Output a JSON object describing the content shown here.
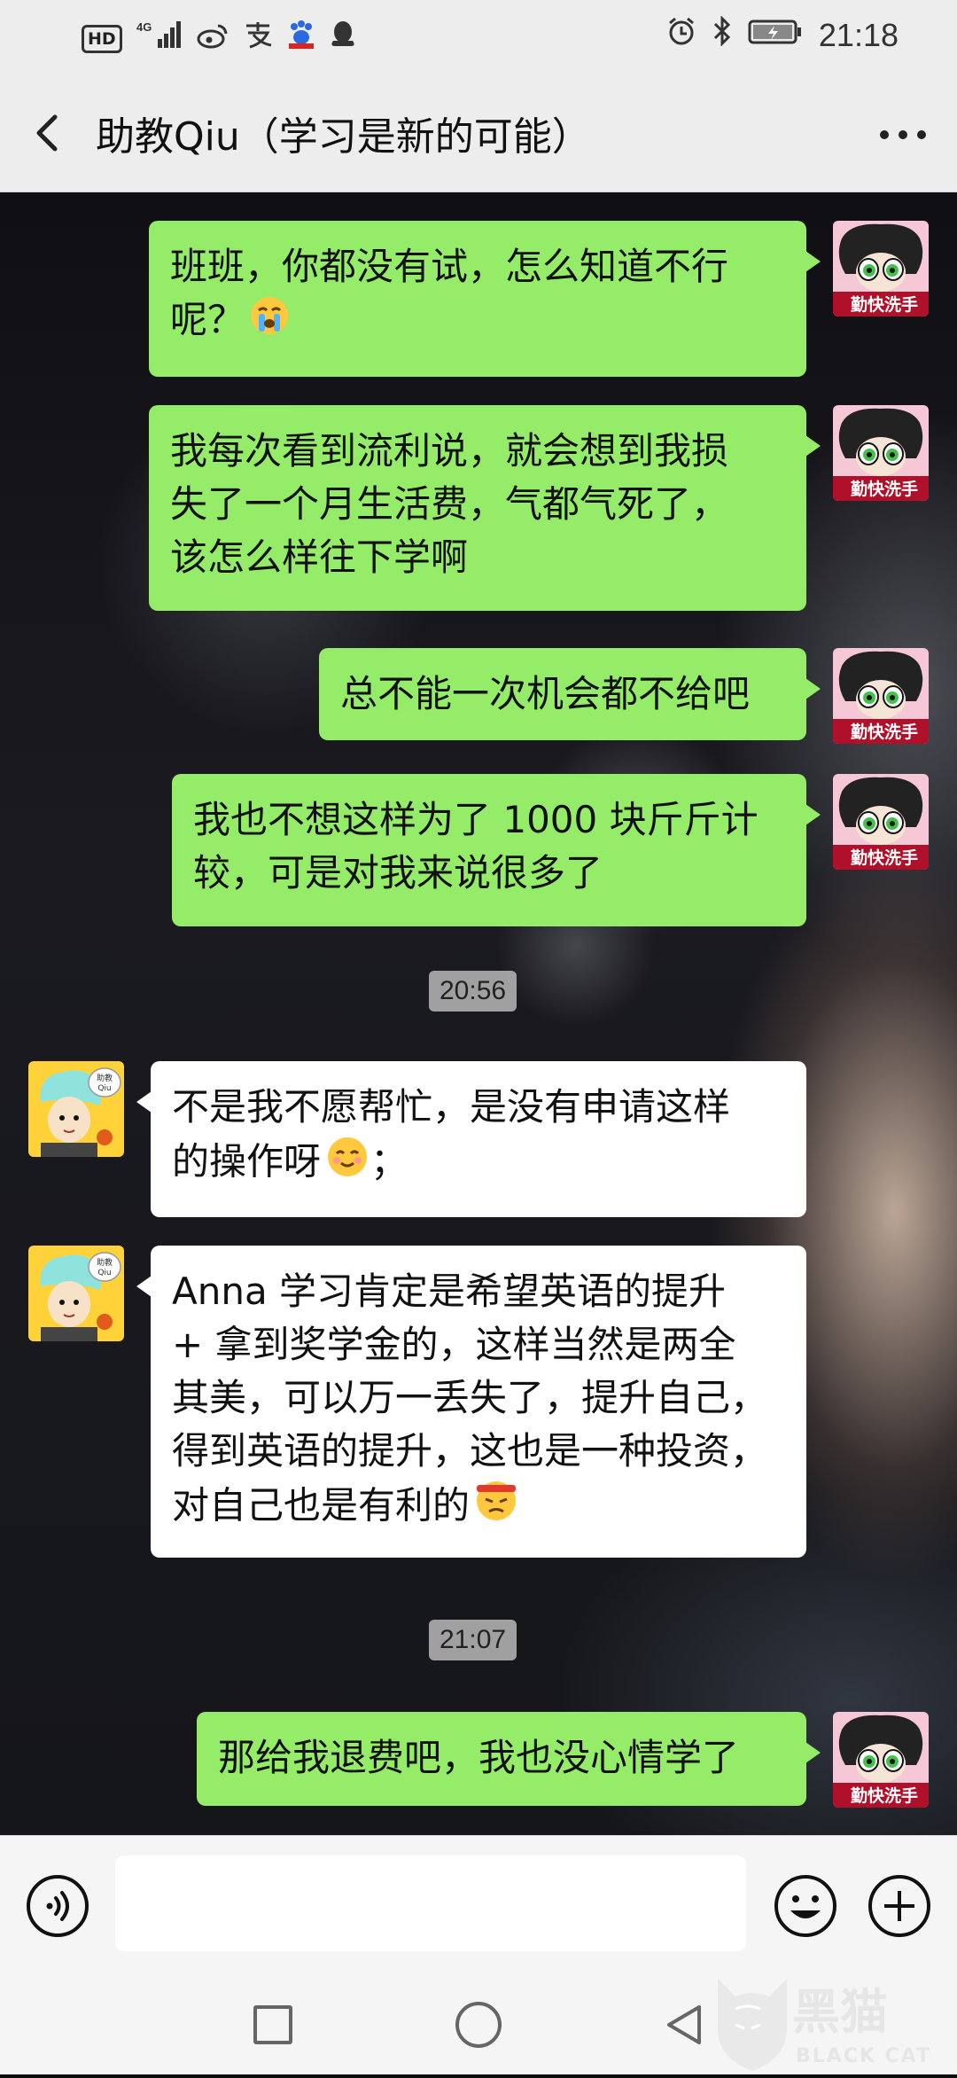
{
  "status_bar": {
    "hd": "HD",
    "network": "4G",
    "time": "21:18"
  },
  "header": {
    "title": "助教Qiu（学习是新的可能）",
    "back_icon": "chevron-left-icon",
    "more_icon": "more-dots-icon"
  },
  "messages": [
    {
      "side": "me",
      "lines": [
        "班班，你都没有试，怎么知道不行",
        "呢？"
      ],
      "emoji": "crying-face"
    },
    {
      "side": "me",
      "lines": [
        "我每次看到流利说，就会想到我损",
        "失了一个月生活费，气都气死了，",
        "该怎么样往下学啊"
      ]
    },
    {
      "side": "me",
      "lines": [
        "总不能一次机会都不给吧"
      ]
    },
    {
      "side": "me",
      "lines": [
        "我也不想这样为了 1000 块斤斤计",
        "较，可是对我来说很多了"
      ]
    },
    {
      "side": "them",
      "lines": [
        "不是我不愿帮忙，是没有申请这样",
        "的操作呀"
      ],
      "emoji": "smiling-face",
      "suffix": "；"
    },
    {
      "side": "them",
      "lines": [
        "Anna 学习肯定是希望英语的提升",
        "+ 拿到奖学金的，这样当然是两全",
        "其美，可以万一丢失了，提升自己，",
        "得到英语的提升，这也是一种投资，",
        "对自己也是有利的"
      ],
      "emoji": "determined-face"
    },
    {
      "side": "me",
      "lines": [
        "那给我退费吧，我也没心情学了"
      ]
    }
  ],
  "timestamps": [
    "20:56",
    "21:07"
  ],
  "avatars": {
    "me_label": "勤快洗手",
    "them_label_1": "助教",
    "them_label_2": "Qiu"
  },
  "input_bar": {
    "placeholder": "",
    "voice_icon": "voice-icon",
    "emoji_icon": "emoji-icon",
    "plus_icon": "plus-icon"
  },
  "watermark": {
    "cn": "黑猫",
    "en": "BLACK CAT"
  },
  "colors": {
    "my_bubble": "#95ec69",
    "their_bubble": "#ffffff",
    "bar_bg": "#ededed"
  }
}
